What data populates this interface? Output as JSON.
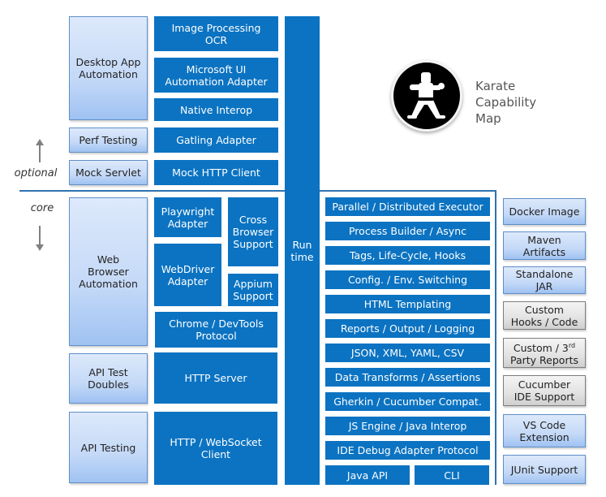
{
  "title": "Karate\nCapability\nMap",
  "logo": {
    "icon": "karate-figure-icon"
  },
  "layer_labels": {
    "optional": "optional",
    "core": "core"
  },
  "runtime": {
    "label": "Run\ntime"
  },
  "optional_layer": {
    "categories": [
      {
        "label": "Desktop App\nAutomation"
      },
      {
        "label": "Perf Testing"
      },
      {
        "label": "Mock Servlet"
      }
    ],
    "components": [
      {
        "label": "Image Processing\nOCR"
      },
      {
        "label": "Microsoft UI\nAutomation Adapter"
      },
      {
        "label": "Native Interop"
      },
      {
        "label": "Gatling Adapter"
      },
      {
        "label": "Mock HTTP Client"
      }
    ]
  },
  "core_layer": {
    "categories": [
      {
        "label": "Web\nBrowser\nAutomation"
      },
      {
        "label": "API Test\nDoubles"
      },
      {
        "label": "API Testing"
      }
    ],
    "components": [
      {
        "label": "Playwright\nAdapter"
      },
      {
        "label": "Cross\nBrowser\nSupport"
      },
      {
        "label": "WebDriver\nAdapter"
      },
      {
        "label": "Appium\nSupport"
      },
      {
        "label": "Chrome / DevTools\nProtocol"
      },
      {
        "label": "HTTP Server"
      },
      {
        "label": "HTTP / WebSocket\nClient"
      }
    ],
    "engine": [
      {
        "label": "Parallel / Distributed Executor"
      },
      {
        "label": "Process Builder / Async"
      },
      {
        "label": "Tags, Life-Cycle, Hooks"
      },
      {
        "label": "Config. / Env. Switching"
      },
      {
        "label": "HTML Templating"
      },
      {
        "label": "Reports / Output / Logging"
      },
      {
        "label": "JSON, XML, YAML, CSV"
      },
      {
        "label": "Data Transforms / Assertions"
      },
      {
        "label": "Gherkin / Cucumber Compat."
      },
      {
        "label": "JS Engine / Java Interop"
      },
      {
        "label": "IDE Debug Adapter Protocol"
      }
    ],
    "interfaces": [
      {
        "label": "Java API"
      },
      {
        "label": "CLI"
      }
    ]
  },
  "distribution": [
    {
      "label": "Docker Image",
      "style": "blue"
    },
    {
      "label": "Maven\nArtifacts",
      "style": "blue"
    },
    {
      "label": "Standalone\nJAR",
      "style": "blue"
    },
    {
      "label": "Custom\nHooks / Code",
      "style": "gray"
    },
    {
      "label_main": "Custom / 3",
      "label_sup": "rd",
      "label_rest": "Party Reports",
      "style": "gray"
    },
    {
      "label": "Cucumber\nIDE Support",
      "style": "gray"
    },
    {
      "label": "VS Code\nExtension",
      "style": "blue"
    },
    {
      "label": "JUnit Support",
      "style": "blue"
    }
  ],
  "colors": {
    "primary_blue": "#0b73c2",
    "light_blue": "#c4d9f7",
    "gray": "#e2e2e2",
    "separator": "#2e73b0"
  }
}
